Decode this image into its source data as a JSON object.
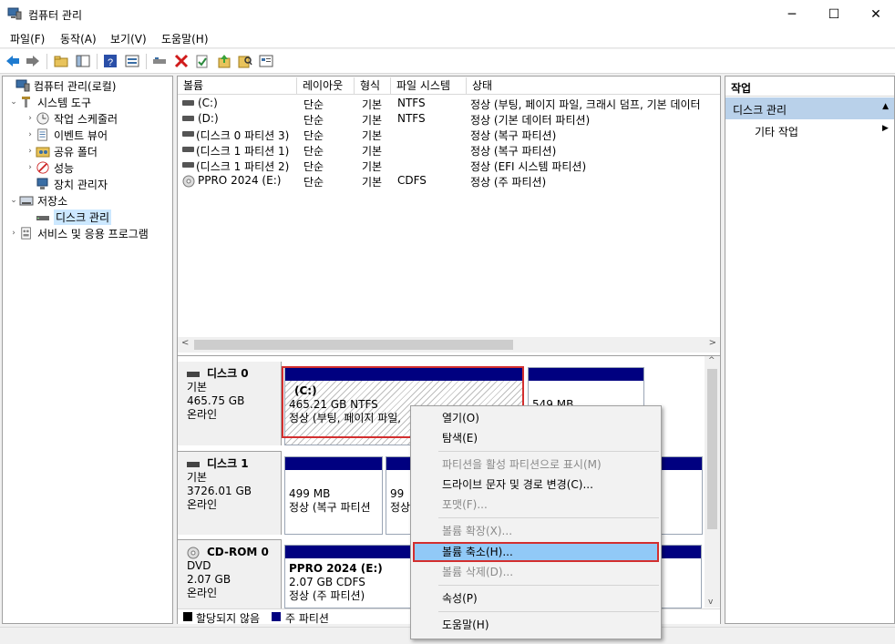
{
  "window": {
    "title": "컴퓨터 관리",
    "minimize": "─",
    "maximize": "☐",
    "close": "✕"
  },
  "menubar": [
    "파일(F)",
    "동작(A)",
    "보기(V)",
    "도움말(H)"
  ],
  "toolbar": {
    "icons": [
      "back-icon",
      "forward-icon",
      "up-folder-icon",
      "show-hide-tree-icon",
      "help-icon",
      "properties-view-icon",
      "connect-icon",
      "delete-icon",
      "check-icon",
      "export-icon",
      "search-icon",
      "console-icon"
    ]
  },
  "tree": {
    "items": [
      {
        "label": "컴퓨터 관리(로컬)",
        "level": 0,
        "expander": ""
      },
      {
        "label": "시스템 도구",
        "level": 1,
        "expander": "⌄"
      },
      {
        "label": "작업 스케줄러",
        "level": 2,
        "expander": "›"
      },
      {
        "label": "이벤트 뷰어",
        "level": 2,
        "expander": "›"
      },
      {
        "label": "공유 폴더",
        "level": 2,
        "expander": "›"
      },
      {
        "label": "성능",
        "level": 2,
        "expander": "›"
      },
      {
        "label": "장치 관리자",
        "level": 2,
        "expander": ""
      },
      {
        "label": "저장소",
        "level": 1,
        "expander": "⌄"
      },
      {
        "label": "디스크 관리",
        "level": 2,
        "expander": ""
      },
      {
        "label": "서비스 및 응용 프로그램",
        "level": 1,
        "expander": "›"
      }
    ]
  },
  "volume_list": {
    "columns": [
      "볼륨",
      "레이아웃",
      "형식",
      "파일 시스템",
      "상태"
    ],
    "rows": [
      {
        "volume": "(C:)",
        "layout": "단순",
        "type": "기본",
        "fs": "NTFS",
        "status": "정상 (부팅, 페이지 파일, 크래시 덤프, 기본 데이터"
      },
      {
        "volume": "(D:)",
        "layout": "단순",
        "type": "기본",
        "fs": "NTFS",
        "status": "정상 (기본 데이터 파티션)"
      },
      {
        "volume": "(디스크 0 파티션 3)",
        "layout": "단순",
        "type": "기본",
        "fs": "",
        "status": "정상 (복구 파티션)"
      },
      {
        "volume": "(디스크 1 파티션 1)",
        "layout": "단순",
        "type": "기본",
        "fs": "",
        "status": "정상 (복구 파티션)"
      },
      {
        "volume": "(디스크 1 파티션 2)",
        "layout": "단순",
        "type": "기본",
        "fs": "",
        "status": "정상 (EFI 시스템 파티션)"
      },
      {
        "volume": "PPRO 2024 (E:)",
        "layout": "단순",
        "type": "기본",
        "fs": "CDFS",
        "status": "정상 (주 파티션)"
      }
    ]
  },
  "disks": [
    {
      "name": "디스크 0",
      "type": "기본",
      "size": "465.75 GB",
      "state": "온라인",
      "partitions": [
        {
          "title": "(C:)",
          "size": "465.21 GB NTFS",
          "status": "정상 (부팅, 페이지 파일,"
        },
        {
          "title": "",
          "size": "549 MB",
          "status": ""
        }
      ]
    },
    {
      "name": "디스크 1",
      "type": "기본",
      "size": "3726.01 GB",
      "state": "온라인",
      "partitions": [
        {
          "title": "",
          "size": "499 MB",
          "status": "정상 (복구 파티션"
        },
        {
          "title": "",
          "size": "99",
          "status": "정상"
        }
      ]
    },
    {
      "name": "CD-ROM 0",
      "type": "DVD",
      "size": "2.07 GB",
      "state": "온라인",
      "partitions": [
        {
          "title": "PPRO 2024  (E:)",
          "size": "2.07 GB CDFS",
          "status": "정상 (주 파티션)"
        }
      ]
    }
  ],
  "legend": [
    {
      "label": "할당되지 않음",
      "color": "#000000"
    },
    {
      "label": "주 파티션",
      "color": "#000080"
    }
  ],
  "actions": {
    "header": "작업",
    "section": "디스크 관리",
    "item": "기타 작업"
  },
  "context_menu": {
    "items": [
      {
        "label": "열기(O)",
        "enabled": true
      },
      {
        "label": "탐색(E)",
        "enabled": true
      },
      {
        "label": "파티션을 활성 파티션으로 표시(M)",
        "enabled": false
      },
      {
        "label": "드라이브 문자 및 경로 변경(C)...",
        "enabled": true
      },
      {
        "label": "포맷(F)...",
        "enabled": false
      },
      {
        "label": "볼륨 확장(X)...",
        "enabled": false
      },
      {
        "label": "볼륨 축소(H)...",
        "enabled": true
      },
      {
        "label": "볼륨 삭제(D)...",
        "enabled": false
      },
      {
        "label": "속성(P)",
        "enabled": true
      },
      {
        "label": "도움말(H)",
        "enabled": true
      }
    ]
  }
}
